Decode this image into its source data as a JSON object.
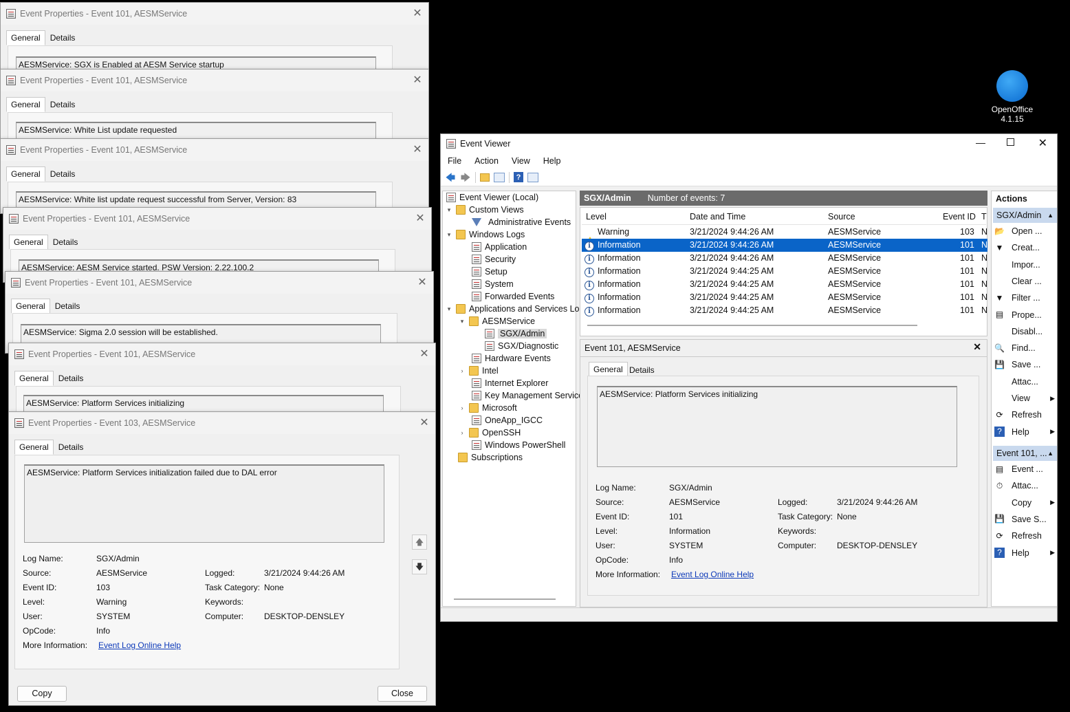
{
  "desktop": {
    "openoffice_label_line1": "OpenOffice",
    "openoffice_label_line2": "4.1.15"
  },
  "prop_windows": [
    {
      "title": "Event Properties - Event 101, AESMService",
      "message": "AESMService: SGX is Enabled at AESM Service startup"
    },
    {
      "title": "Event Properties - Event 101, AESMService",
      "message": "AESMService: White List update requested"
    },
    {
      "title": "Event Properties - Event 101, AESMService",
      "message": "AESMService: White list update request successful from Server, Version: 83"
    },
    {
      "title": "Event Properties - Event 101, AESMService",
      "message": "AESMService: AESM Service started. PSW Version: 2.22.100.2"
    },
    {
      "title": "Event Properties - Event 101, AESMService",
      "message": "AESMService: Sigma 2.0 session will be established."
    },
    {
      "title": "Event Properties - Event 101, AESMService",
      "message": "AESMService: Platform Services initializing"
    }
  ],
  "tabs": {
    "general": "General",
    "details": "Details"
  },
  "front_window": {
    "title": "Event Properties - Event 103, AESMService",
    "message": "AESMService: Platform Services initialization failed due to DAL error",
    "log_name_label": "Log Name:",
    "log_name": "SGX/Admin",
    "source_label": "Source:",
    "source": "AESMService",
    "logged_label": "Logged:",
    "logged": "3/21/2024 9:44:26 AM",
    "event_id_label": "Event ID:",
    "event_id": "103",
    "task_category_label": "Task Category:",
    "task_category": "None",
    "level_label": "Level:",
    "level": "Warning",
    "keywords_label": "Keywords:",
    "user_label": "User:",
    "user": "SYSTEM",
    "computer_label": "Computer:",
    "computer": "DESKTOP-DENSLEY",
    "opcode_label": "OpCode:",
    "opcode": "Info",
    "more_info_label": "More Information:",
    "more_info_link": "Event Log Online Help",
    "copy_button": "Copy",
    "close_button": "Close"
  },
  "event_viewer": {
    "title": "Event Viewer",
    "menu": [
      "File",
      "Action",
      "View",
      "Help"
    ],
    "tree": {
      "root": "Event Viewer (Local)",
      "custom_views": "Custom Views",
      "administrative_events": "Administrative Events",
      "windows_logs": "Windows Logs",
      "application": "Application",
      "security": "Security",
      "setup": "Setup",
      "system": "System",
      "forwarded_events": "Forwarded Events",
      "apps_services": "Applications and Services Lo",
      "aesmservice": "AESMService",
      "sgx_admin": "SGX/Admin",
      "sgx_diagnostic": "SGX/Diagnostic",
      "hardware_events": "Hardware Events",
      "intel": "Intel",
      "internet_explorer": "Internet Explorer",
      "key_management": "Key Management Service",
      "microsoft": "Microsoft",
      "oneapp": "OneApp_IGCC",
      "openssh": "OpenSSH",
      "powershell": "Windows PowerShell",
      "subscriptions": "Subscriptions"
    },
    "center": {
      "log_name": "SGX/Admin",
      "count_text": "Number of events: 7",
      "columns": {
        "level": "Level",
        "datetime": "Date and Time",
        "source": "Source",
        "event_id": "Event ID",
        "task": "T"
      },
      "rows": [
        {
          "level": "Warning",
          "datetime": "3/21/2024 9:44:26 AM",
          "source": "AESMService",
          "event_id": "103",
          "task": "N"
        },
        {
          "level": "Information",
          "datetime": "3/21/2024 9:44:26 AM",
          "source": "AESMService",
          "event_id": "101",
          "task": "N"
        },
        {
          "level": "Information",
          "datetime": "3/21/2024 9:44:26 AM",
          "source": "AESMService",
          "event_id": "101",
          "task": "N"
        },
        {
          "level": "Information",
          "datetime": "3/21/2024 9:44:25 AM",
          "source": "AESMService",
          "event_id": "101",
          "task": "N"
        },
        {
          "level": "Information",
          "datetime": "3/21/2024 9:44:25 AM",
          "source": "AESMService",
          "event_id": "101",
          "task": "N"
        },
        {
          "level": "Information",
          "datetime": "3/21/2024 9:44:25 AM",
          "source": "AESMService",
          "event_id": "101",
          "task": "N"
        },
        {
          "level": "Information",
          "datetime": "3/21/2024 9:44:25 AM",
          "source": "AESMService",
          "event_id": "101",
          "task": "N"
        }
      ]
    },
    "detail": {
      "title": "Event 101, AESMService",
      "message": "AESMService: Platform Services initializing",
      "log_name": "SGX/Admin",
      "source": "AESMService",
      "logged": "3/21/2024 9:44:26 AM",
      "event_id": "101",
      "task_category": "None",
      "level": "Information",
      "user": "SYSTEM",
      "computer": "DESKTOP-DENSLEY",
      "opcode": "Info",
      "more_info_link": "Event Log Online Help"
    },
    "actions": {
      "header": "Actions",
      "group1_title": "SGX/Admin",
      "group1": [
        "Open ...",
        "Creat...",
        "Impor...",
        "Clear ...",
        "Filter ...",
        "Prope...",
        "Disabl...",
        "Find...",
        "Save ...",
        "Attac...",
        "View",
        "Refresh",
        "Help"
      ],
      "group2_title": "Event 101, ...",
      "group2": [
        "Event ...",
        "Attac...",
        "Copy",
        "Save S...",
        "Refresh",
        "Help"
      ]
    }
  }
}
